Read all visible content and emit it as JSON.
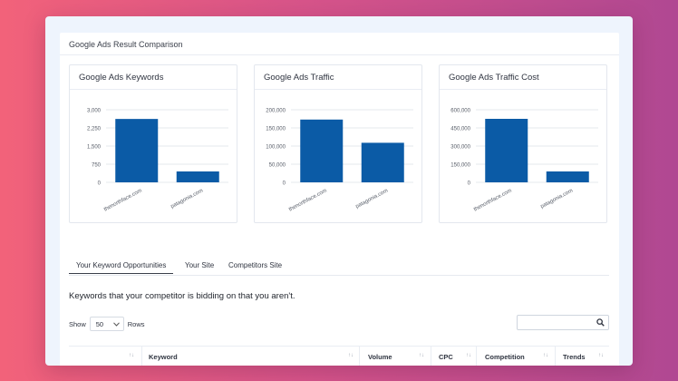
{
  "comparison": {
    "title": "Google Ads Result Comparison"
  },
  "charts": [
    {
      "title": "Google Ads Keywords"
    },
    {
      "title": "Google Ads Traffic"
    },
    {
      "title": "Google Ads Traffic Cost"
    }
  ],
  "chart_data": [
    {
      "type": "bar",
      "title": "Google Ads Keywords",
      "categories": [
        "thenorthface.com",
        "patagonia.com"
      ],
      "values": [
        2620,
        450
      ],
      "ylim": [
        0,
        3000
      ],
      "yticks": [
        "0",
        "750",
        "1,500",
        "2,250",
        "3,000"
      ],
      "color": "#0b5ba6"
    },
    {
      "type": "bar",
      "title": "Google Ads Traffic",
      "categories": [
        "thenorthface.com",
        "patagonia.com"
      ],
      "values": [
        173000,
        109000
      ],
      "ylim": [
        0,
        200000
      ],
      "yticks": [
        "0",
        "50,000",
        "100,000",
        "150,000",
        "200,000"
      ],
      "color": "#0b5ba6"
    },
    {
      "type": "bar",
      "title": "Google Ads Traffic Cost",
      "categories": [
        "thenorthface.com",
        "patagonia.com"
      ],
      "values": [
        525000,
        90000
      ],
      "ylim": [
        0,
        600000
      ],
      "yticks": [
        "0",
        "150,000",
        "300,000",
        "450,000",
        "600,000"
      ],
      "color": "#0b5ba6"
    }
  ],
  "tabs": {
    "opportunities": "Your Keyword Opportunities",
    "your_site": "Your Site",
    "competitors": "Competitors Site"
  },
  "heading": "Keywords that your competitor is bidding on that you aren't.",
  "pager": {
    "show": "Show",
    "rows_value": "50",
    "rows": "Rows"
  },
  "search": {
    "placeholder": ""
  },
  "table": {
    "columns": [
      "Keyword",
      "Volume",
      "CPC",
      "Competition",
      "Trends"
    ]
  }
}
